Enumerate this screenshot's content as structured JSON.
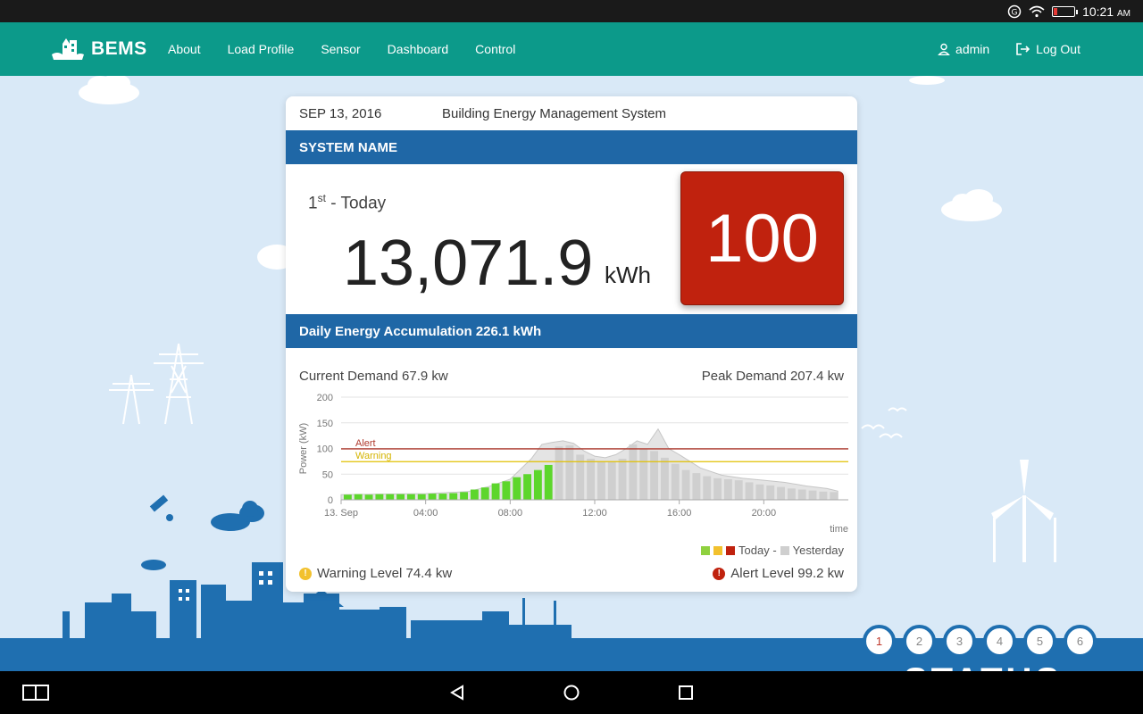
{
  "status_bar": {
    "time": "10:21",
    "ampm": "AM"
  },
  "navbar": {
    "brand": "BEMS",
    "links": [
      "About",
      "Load Profile",
      "Sensor",
      "Dashboard",
      "Control"
    ],
    "user": "admin",
    "logout": "Log Out",
    "color": "#0c9a8a"
  },
  "card": {
    "date": "SEP 13, 2016",
    "subtitle": "Building Energy Management System",
    "system_name": "SYSTEM NAME",
    "rank_num": "1",
    "rank_sup": "st",
    "rank_label": "- Today",
    "energy_value": "13,071.9",
    "energy_unit": "kWh",
    "score": "100",
    "accumulation": "Daily Energy Accumulation 226.1 kWh",
    "current_demand": "Current Demand 67.9 kw",
    "peak_demand": "Peak Demand 207.4 kw",
    "legend_today": "Today -",
    "legend_yesterday": "Yesterday",
    "warning_level": "Warning Level 74.4 kw",
    "alert_level": "Alert Level 99.2 kw"
  },
  "pager": {
    "pages": [
      "1",
      "2",
      "3",
      "4",
      "5",
      "6"
    ],
    "active": 0
  },
  "status_word": "STATUS",
  "colors": {
    "header_blue": "#1f67a6",
    "score_red": "#c0220e",
    "today_green": "#5dd62c",
    "yesterday_grey": "#d3d3d3",
    "alert_line": "#b03a2e",
    "warning_line": "#e0c000"
  },
  "chart_data": {
    "type": "bar",
    "ylabel": "Power (kW)",
    "xlabel": "time",
    "ylim": [
      0,
      200
    ],
    "yticks": [
      0,
      50,
      100,
      150,
      200
    ],
    "x_tick_labels": [
      "13. Sep",
      "04:00",
      "08:00",
      "12:00",
      "16:00",
      "20:00"
    ],
    "x_tick_hours": [
      0,
      4,
      8,
      12,
      16,
      20
    ],
    "x_range_hours": [
      0,
      24
    ],
    "alert": {
      "label": "Alert",
      "value": 99.2
    },
    "warning": {
      "label": "Warning",
      "value": 74.4
    },
    "series": [
      {
        "name": "Today",
        "hours": [
          0.5,
          1,
          1.5,
          2,
          2.5,
          3,
          3.5,
          4,
          4.5,
          5,
          5.5,
          6,
          6.5,
          7,
          7.5,
          8,
          8.5,
          9,
          9.5,
          10
        ],
        "values": [
          10,
          11,
          10,
          11,
          11,
          11,
          11,
          11,
          12,
          12,
          13,
          15,
          20,
          24,
          32,
          36,
          44,
          50,
          58,
          67.9
        ]
      },
      {
        "name": "Yesterday",
        "hours": [
          10.5,
          11,
          11.5,
          12,
          12.5,
          13,
          13.5,
          14,
          14.5,
          15,
          15.5,
          16,
          16.5,
          17,
          17.5,
          18,
          18.5,
          19,
          19.5,
          20,
          20.5,
          21,
          21.5,
          22,
          22.5,
          23,
          23.5
        ],
        "values": [
          104,
          106,
          88,
          80,
          74,
          74,
          80,
          108,
          100,
          95,
          82,
          70,
          58,
          52,
          46,
          42,
          40,
          38,
          34,
          30,
          28,
          25,
          22,
          20,
          18,
          16,
          15
        ]
      }
    ],
    "yesterday_envelope_hours": [
      0,
      2,
      4,
      6,
      7,
      8,
      8.5,
      9,
      9.5,
      10,
      10.5,
      11,
      11.5,
      12,
      12.5,
      13,
      13.5,
      14,
      14.5,
      15,
      15.5,
      16,
      17,
      18,
      19,
      20,
      21,
      22,
      23,
      23.5
    ],
    "yesterday_envelope_values": [
      10,
      11,
      12,
      16,
      26,
      40,
      60,
      80,
      108,
      112,
      115,
      110,
      95,
      85,
      82,
      88,
      100,
      115,
      108,
      138,
      100,
      88,
      62,
      48,
      42,
      38,
      34,
      27,
      22,
      17
    ]
  }
}
